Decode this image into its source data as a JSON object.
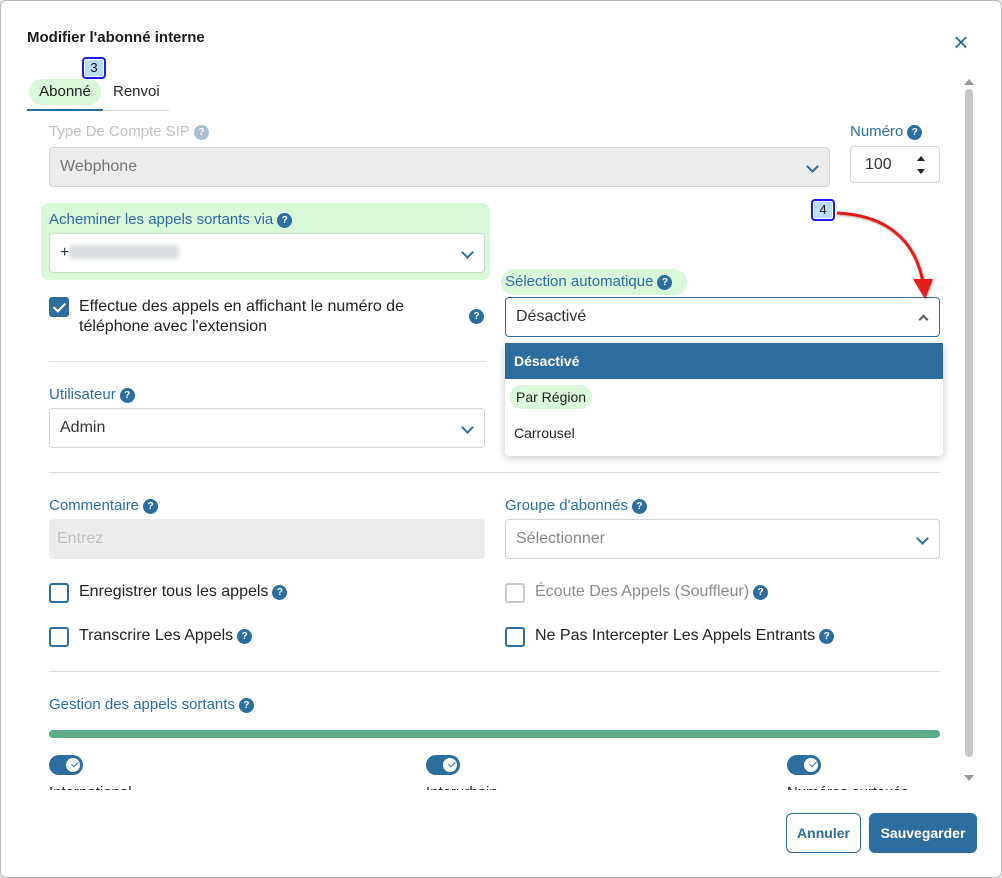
{
  "modal": {
    "title": "Modifier l'abonné interne",
    "close_symbol": "×"
  },
  "tabs": [
    {
      "label": "Abonné"
    },
    {
      "label": "Renvoi"
    }
  ],
  "annotations": {
    "step_3": "3",
    "step_4": "4"
  },
  "help_symbol": "?",
  "sip_type": {
    "label": "Type De Compte SIP",
    "value": "Webphone"
  },
  "number": {
    "label": "Numéro",
    "value": "100"
  },
  "outgoing_route": {
    "label": "Acheminer les appels sortants via",
    "value_prefix": "+"
  },
  "auto_selection": {
    "label": "Sélection automatique",
    "value": "Désactivé",
    "options": [
      "Désactivé",
      "Par Région",
      "Carrousel"
    ]
  },
  "show_number_checkbox": {
    "label": "Effectue des appels en affichant le numéro de téléphone avec l'extension",
    "checked": true
  },
  "user": {
    "label": "Utilisateur",
    "value": "Admin"
  },
  "comment": {
    "label": "Commentaire",
    "placeholder": "Entrez"
  },
  "subscriber_group": {
    "label": "Groupe d'abonnés",
    "placeholder": "Sélectionner"
  },
  "checkboxes": {
    "record_calls": "Enregistrer tous les appels",
    "listen_calls": "Écoute Des Appels (Souffleur)",
    "transcribe_calls": "Transcrire Les Appels",
    "no_intercept": "Ne Pas Intercepter Les Appels Entrants"
  },
  "outgoing_management": {
    "label": "Gestion des appels sortants",
    "progress_percent": 100
  },
  "toggles": [
    {
      "label": "International",
      "on": true
    },
    {
      "label": "Interurbain",
      "on": true
    },
    {
      "label": "Numéros surtaxés",
      "on": true
    }
  ],
  "footer": {
    "cancel_label": "Annuler",
    "save_label": "Sauvegarder"
  },
  "colors": {
    "accent": "#2c6ea0",
    "highlight": "#d9f7d9",
    "progress": "#5aad86",
    "annotation": "#1d1df2",
    "arrow": "#e41e1e"
  }
}
